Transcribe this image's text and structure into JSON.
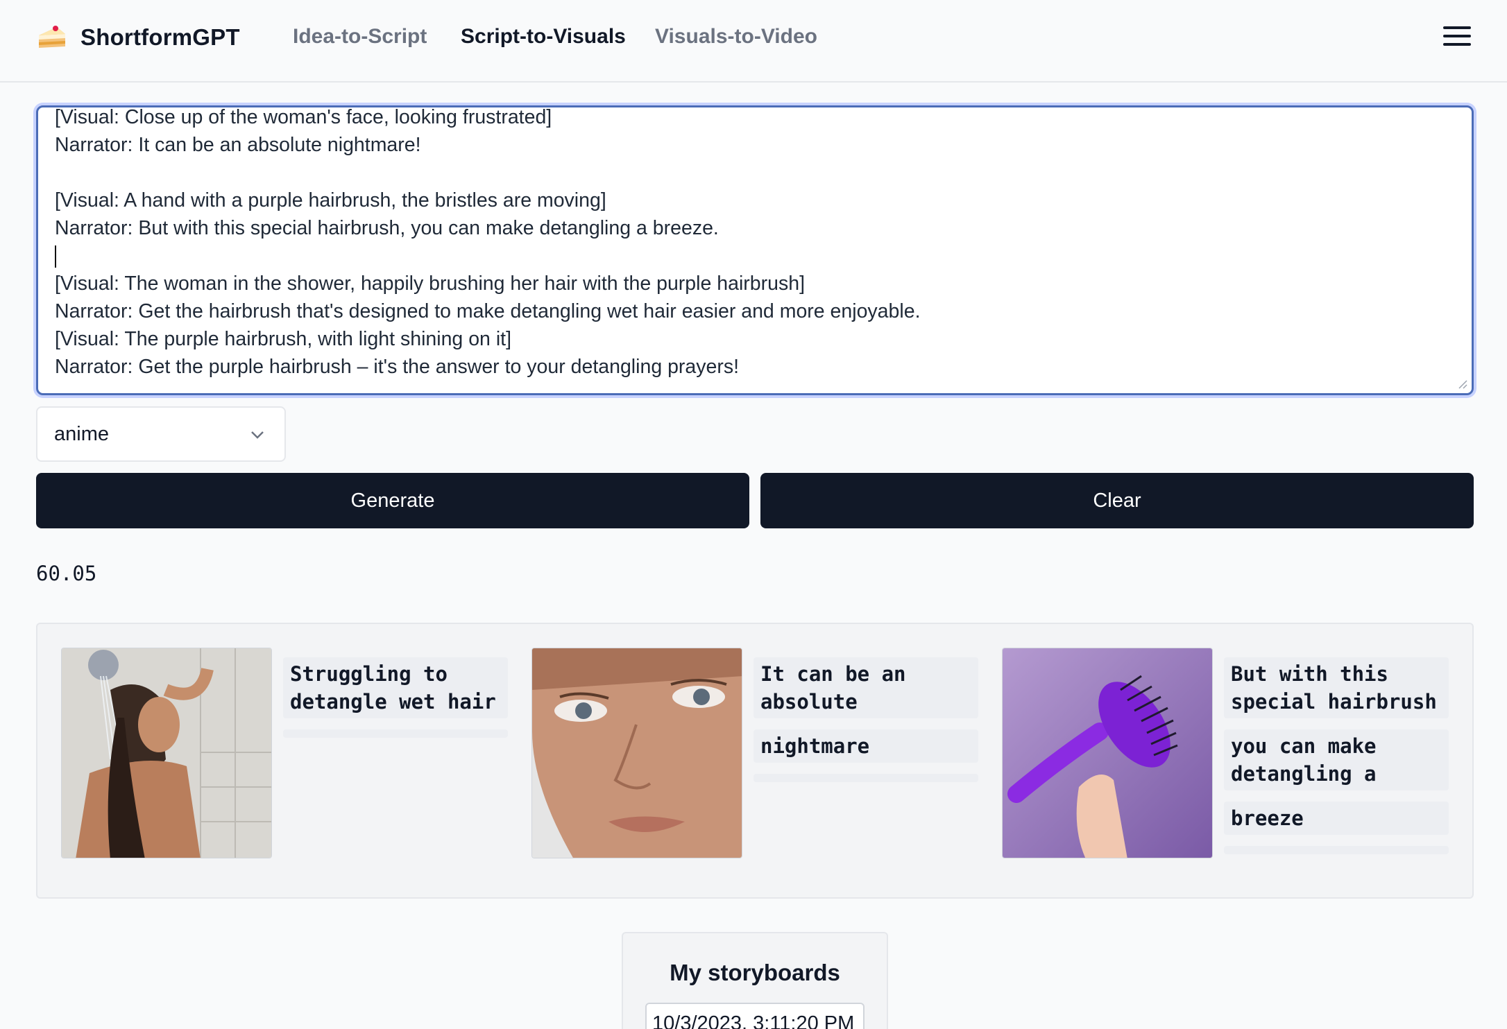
{
  "header": {
    "brand": "ShortformGPT",
    "nav": [
      {
        "label": "Idea-to-Script",
        "active": false
      },
      {
        "label": "Script-to-Visuals",
        "active": true
      },
      {
        "label": "Visuals-to-Video",
        "active": false
      }
    ]
  },
  "script": {
    "lines": [
      "[Visual: Close up of the woman's face, looking frustrated]",
      "Narrator: It can be an absolute nightmare!",
      "",
      "[Visual: A hand with a purple hairbrush, the bristles are moving]",
      "Narrator: But with this special hairbrush, you can make detangling a breeze.",
      "",
      "[Visual: The woman in the shower, happily brushing her hair with the purple hairbrush]",
      "Narrator: Get the hairbrush that's designed to make detangling wet hair easier and more enjoyable.",
      "[Visual: The purple hairbrush, with light shining on it]",
      "Narrator: Get the purple hairbrush – it's the answer to your detangling prayers!"
    ]
  },
  "style_select": {
    "value": "anime"
  },
  "buttons": {
    "generate": "Generate",
    "clear": "Clear"
  },
  "timer": "60.05",
  "storyboard": {
    "scenes": [
      {
        "image": "woman-in-shower",
        "captions": [
          "Struggling to detangle wet hair"
        ]
      },
      {
        "image": "face-close-up",
        "captions": [
          "It can be an absolute",
          "nightmare"
        ]
      },
      {
        "image": "purple-hairbrush",
        "captions": [
          "But with this special hairbrush",
          "you can make detangling a",
          "breeze"
        ]
      }
    ]
  },
  "my_storyboards": {
    "title": "My storyboards",
    "items": [
      "10/3/2023, 3:11:20 PM"
    ]
  },
  "colors": {
    "accent": "#111827",
    "focus_ring": "#4b6cb7",
    "brush_purple": "#8b2be2"
  }
}
